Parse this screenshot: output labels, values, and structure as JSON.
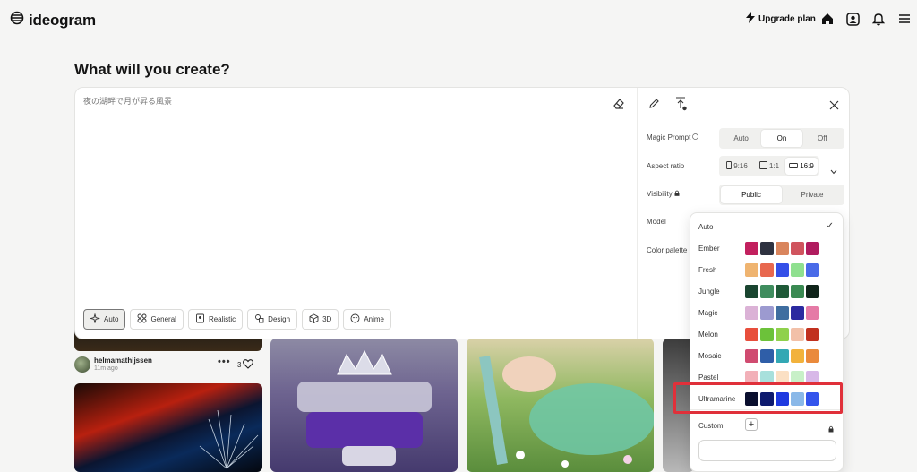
{
  "header": {
    "logo_text": "ideogram",
    "upgrade_label": "Upgrade plan",
    "icons": [
      "bolt-icon",
      "home-icon",
      "profile-icon",
      "bell-icon",
      "menu-icon"
    ]
  },
  "page_title": "What will you create?",
  "prompt": {
    "text": "夜の湖畔で月が昇る風景"
  },
  "styles": [
    {
      "label": "Auto",
      "icon": "sparkle-icon",
      "active": true
    },
    {
      "label": "General",
      "icon": "grid-icon"
    },
    {
      "label": "Realistic",
      "icon": "frame-icon"
    },
    {
      "label": "Design",
      "icon": "shapes-icon"
    },
    {
      "label": "3D",
      "icon": "cube-icon"
    },
    {
      "label": "Anime",
      "icon": "face-icon"
    }
  ],
  "settings": {
    "magic_prompt": {
      "label": "Magic Prompt",
      "options": [
        "Auto",
        "On",
        "Off"
      ],
      "selected": "On"
    },
    "aspect_ratio": {
      "label": "Aspect ratio",
      "options": [
        "9:16",
        "1:1",
        "16:9"
      ],
      "selected": "16:9"
    },
    "visibility": {
      "label": "Visibility",
      "options": [
        "Public",
        "Private"
      ],
      "selected": "Public"
    },
    "model": {
      "label": "Model"
    },
    "color_palette": {
      "label": "Color palette"
    }
  },
  "palette_dropdown": {
    "options": [
      {
        "label": "Auto",
        "checked": true,
        "colors": []
      },
      {
        "label": "Ember",
        "colors": [
          "#c2205e",
          "#2e3240",
          "#d9855d",
          "#d0545e",
          "#b01c5f"
        ]
      },
      {
        "label": "Fresh",
        "colors": [
          "#efb470",
          "#e8684f",
          "#3550e8",
          "#8fe08f",
          "#4a6be8"
        ]
      },
      {
        "label": "Jungle",
        "colors": [
          "#1a4530",
          "#3f8d5e",
          "#1f5a38",
          "#3a8a52",
          "#10241a"
        ]
      },
      {
        "label": "Magic",
        "colors": [
          "#dbb2d6",
          "#9c9ad0",
          "#3f6ea0",
          "#2b2aa0",
          "#e57aa6"
        ]
      },
      {
        "label": "Melon",
        "colors": [
          "#e84e3c",
          "#6cc23a",
          "#8fd14c",
          "#f2c0a8",
          "#c1301e"
        ]
      },
      {
        "label": "Mosaic",
        "colors": [
          "#d04b70",
          "#2f5ea8",
          "#33a8b4",
          "#f2b23c",
          "#ea8a3c"
        ]
      },
      {
        "label": "Pastel",
        "colors": [
          "#f2b0b8",
          "#a8e0dc",
          "#fbe0c4",
          "#c8f0c8",
          "#d8b8e8"
        ]
      },
      {
        "label": "Ultramarine",
        "colors": [
          "#0a0f2e",
          "#0e1a6e",
          "#1f3ae0",
          "#8ab8e8",
          "#3454ec"
        ]
      }
    ],
    "custom_label": "Custom",
    "highlighted": "Ultramarine"
  },
  "gallery": {
    "post": {
      "username": "helmamathijssen",
      "time": "11m ago",
      "likes": "3"
    }
  }
}
